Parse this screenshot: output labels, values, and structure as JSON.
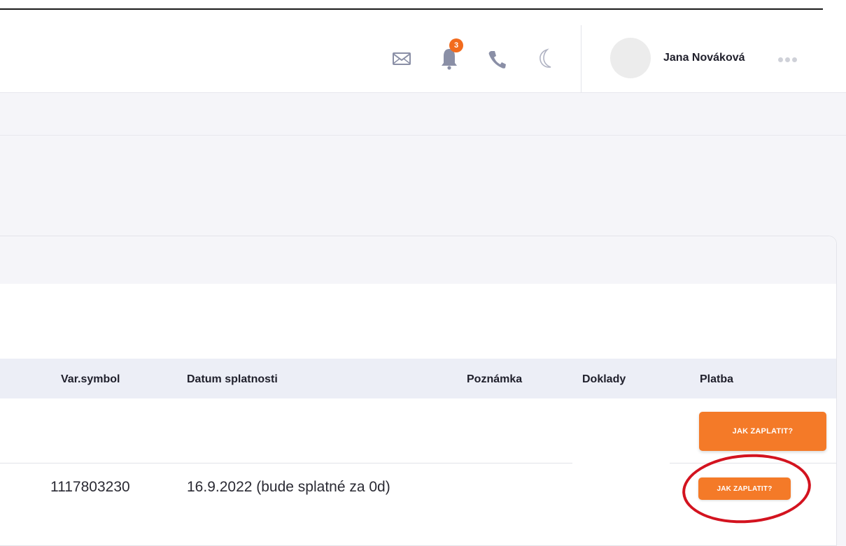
{
  "header": {
    "notification_count": "3",
    "user_name": "Jana Nováková",
    "icons": [
      "mail-icon",
      "bell-icon",
      "phone-icon",
      "moon-icon",
      "more-icon"
    ]
  },
  "table": {
    "columns": [
      "Var.symbol",
      "Datum splatnosti",
      "Poznámka",
      "Doklady",
      "Platba"
    ],
    "rows": [
      {
        "var_symbol": "",
        "datum": "",
        "platba": "JAK ZAPLATIT?"
      },
      {
        "var_symbol": "1117803230",
        "datum": "16.9.2022 (bude splatné za 0d)",
        "platba": "JAK ZAPLATIT?"
      }
    ]
  },
  "colors": {
    "accent": "#f47a28",
    "highlight_circle": "#d3131f",
    "badge": "#f26b1d"
  }
}
